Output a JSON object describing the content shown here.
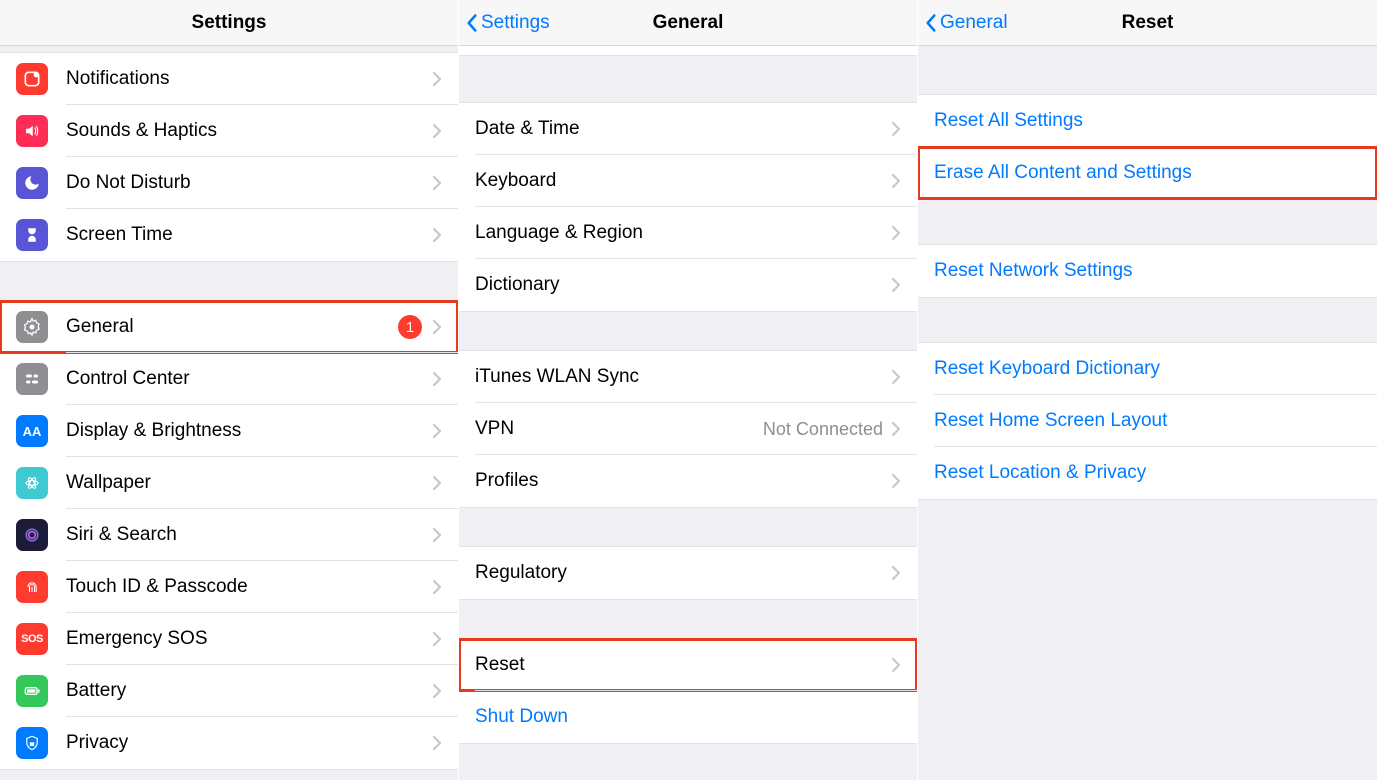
{
  "colors": {
    "blue": "#007aff",
    "red": "#ff3b30",
    "gray": "#8e8e93",
    "highlight": "#e63a1f"
  },
  "panel1": {
    "title": "Settings",
    "group1": [
      {
        "label": "Notifications",
        "icon": "notifications-icon",
        "bg": "#ff3b30"
      },
      {
        "label": "Sounds & Haptics",
        "icon": "sounds-icon",
        "bg": "#ff3b6f"
      },
      {
        "label": "Do Not Disturb",
        "icon": "dnd-icon",
        "bg": "#5856d6"
      },
      {
        "label": "Screen Time",
        "icon": "screentime-icon",
        "bg": "#5856d6"
      }
    ],
    "group2": [
      {
        "label": "General",
        "icon": "general-icon",
        "bg": "#8e8e93",
        "badge": "1",
        "highlight": true
      },
      {
        "label": "Control Center",
        "icon": "control-center-icon",
        "bg": "#8e8e93"
      },
      {
        "label": "Display & Brightness",
        "icon": "display-icon",
        "bg": "#007aff"
      },
      {
        "label": "Wallpaper",
        "icon": "wallpaper-icon",
        "bg": "#4fc1c7"
      },
      {
        "label": "Siri & Search",
        "icon": "siri-icon",
        "bg": "#1a1a2e"
      },
      {
        "label": "Touch ID & Passcode",
        "icon": "touchid-icon",
        "bg": "#ff3b30"
      },
      {
        "label": "Emergency SOS",
        "icon": "sos-icon",
        "bg": "#ff3b30",
        "text": "SOS"
      },
      {
        "label": "Battery",
        "icon": "battery-icon",
        "bg": "#34c759"
      },
      {
        "label": "Privacy",
        "icon": "privacy-icon",
        "bg": "#007aff"
      }
    ]
  },
  "panel2": {
    "back": "Settings",
    "title": "General",
    "group1": [
      {
        "label": "Date & Time"
      },
      {
        "label": "Keyboard"
      },
      {
        "label": "Language & Region"
      },
      {
        "label": "Dictionary"
      }
    ],
    "group2": [
      {
        "label": "iTunes WLAN Sync"
      },
      {
        "label": "VPN",
        "detail": "Not Connected"
      },
      {
        "label": "Profiles"
      }
    ],
    "group3": [
      {
        "label": "Regulatory"
      }
    ],
    "group4": [
      {
        "label": "Reset",
        "highlight": true
      },
      {
        "label": "Shut Down",
        "link": true,
        "noChevron": true
      }
    ]
  },
  "panel3": {
    "back": "General",
    "title": "Reset",
    "group1": [
      {
        "label": "Reset All Settings",
        "link": true
      },
      {
        "label": "Erase All Content and Settings",
        "link": true,
        "highlight": true
      }
    ],
    "group2": [
      {
        "label": "Reset Network Settings",
        "link": true
      }
    ],
    "group3": [
      {
        "label": "Reset Keyboard Dictionary",
        "link": true
      },
      {
        "label": "Reset Home Screen Layout",
        "link": true
      },
      {
        "label": "Reset Location & Privacy",
        "link": true
      }
    ]
  }
}
